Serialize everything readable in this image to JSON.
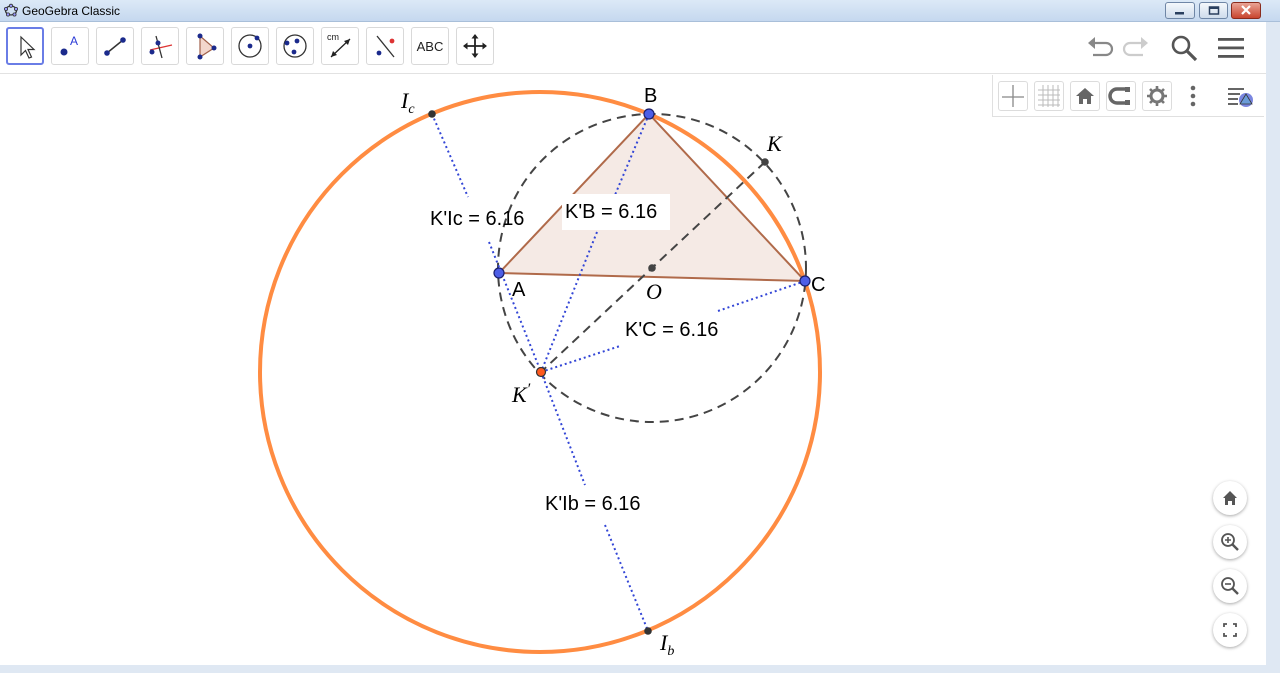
{
  "window": {
    "title": "GeoGebra Classic"
  },
  "toolbar": {
    "tools": [
      {
        "name": "move-tool",
        "selected": true
      },
      {
        "name": "point-tool"
      },
      {
        "name": "line-tool"
      },
      {
        "name": "perpendicular-line-tool"
      },
      {
        "name": "polygon-tool"
      },
      {
        "name": "circle-center-point-tool"
      },
      {
        "name": "circle-three-points-tool"
      },
      {
        "name": "distance-tool",
        "label": "cm"
      },
      {
        "name": "reflect-about-line-tool"
      },
      {
        "name": "text-tool",
        "label": "ABC"
      },
      {
        "name": "move-graphics-view-tool"
      }
    ],
    "right_controls": [
      "undo-icon",
      "redo-icon",
      "search-icon",
      "menu-icon"
    ]
  },
  "style_bar": {
    "buttons": [
      "axes-icon",
      "grid-icon",
      "home-icon",
      "point-capturing-icon",
      "settings-icon",
      "more-icon",
      "toggle-style-bar-icon"
    ]
  },
  "zoom_controls": [
    "home-icon",
    "zoom-in-icon",
    "zoom-out-icon",
    "fullscreen-icon"
  ],
  "colors": {
    "accent": "#6a7de6",
    "circle_orange": "#ff8c42",
    "triangle_fill": "#f3e6e0",
    "triangle_edge": "#b06a4a",
    "point_blue": "#4d5ee6",
    "point_red": "#ff5a1f",
    "dotted_blue": "#3346d6"
  },
  "points": {
    "A": "A",
    "B": "B",
    "C": "C",
    "O": "O",
    "K": "K",
    "Kp": "K",
    "Kp_prime": "′",
    "Ic_main": "I",
    "Ic_sub": "c",
    "Ib_main": "I",
    "Ib_sub": "b"
  },
  "measurements": {
    "kic": "K'Ic = 6.16",
    "kb": "K'B = 6.16",
    "kc": "K'C = 6.16",
    "kib": "K'Ib = 6.16"
  }
}
